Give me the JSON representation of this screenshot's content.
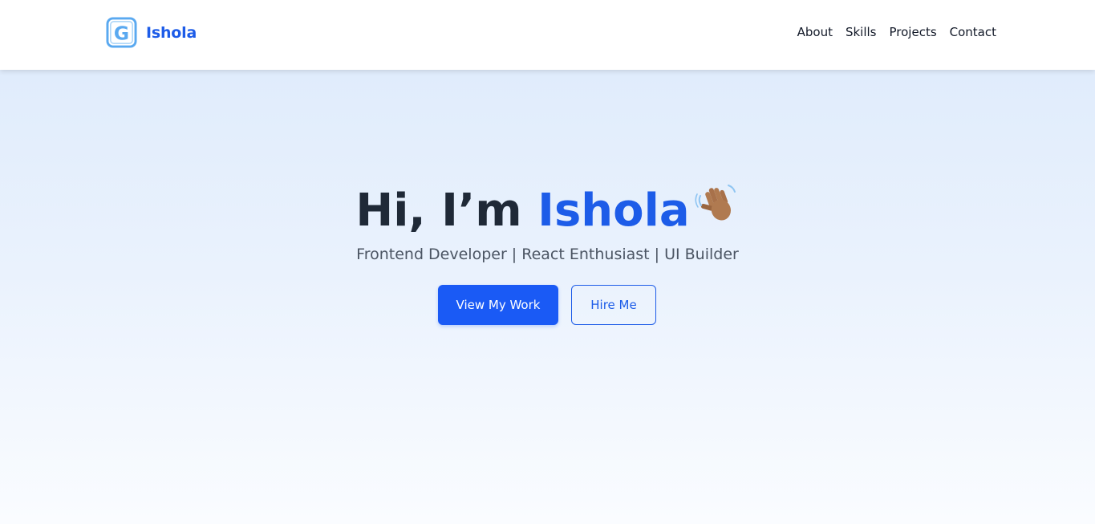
{
  "nav": {
    "brand_letter": "G",
    "brand_name": "Ishola",
    "links": [
      "About",
      "Skills",
      "Projects",
      "Contact"
    ]
  },
  "hero": {
    "greeting": "Hi, I’m",
    "name": "Ishola",
    "wave_emoji": "waving-hand-icon",
    "subtitle": "Frontend Developer | React Enthusiast | UI Builder",
    "primary_button": "View My Work",
    "secondary_button": "Hire Me"
  },
  "colors": {
    "accent": "#1d5ce8",
    "primary_button_bg": "#1a5af5",
    "heading_text": "#1f2937",
    "subtitle_text": "#4b5563",
    "hero_gradient_top": "#e0ecfc",
    "hero_gradient_bottom": "#fafcff",
    "logo_outline": "#5aa9f0"
  }
}
